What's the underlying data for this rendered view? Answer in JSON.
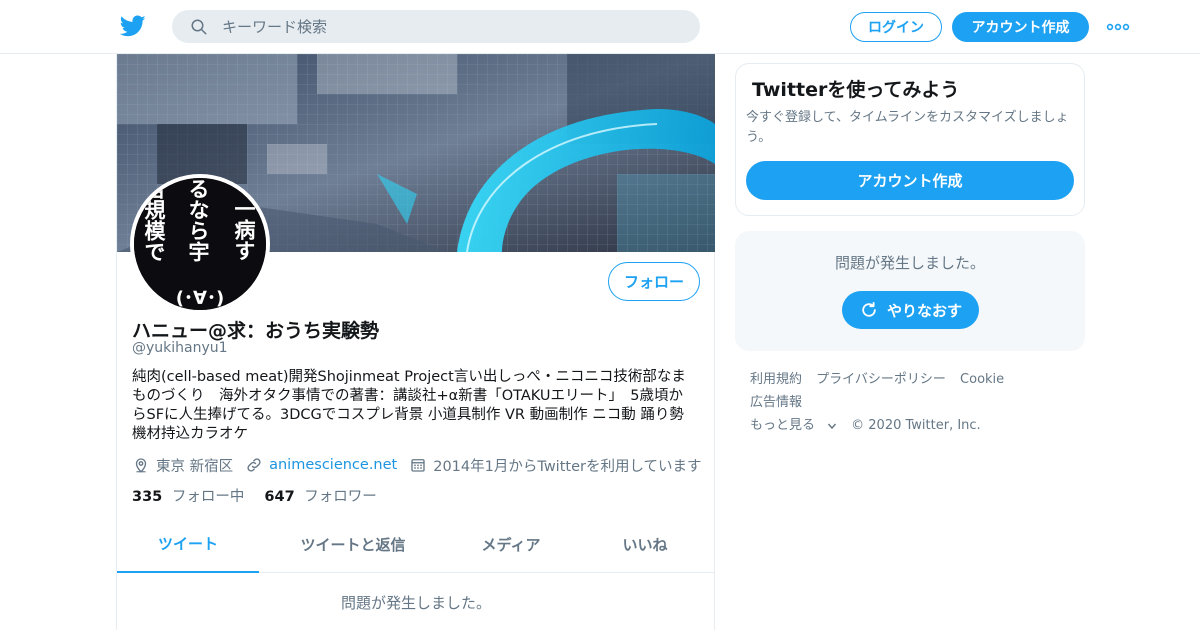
{
  "nav": {
    "search_placeholder": "キーワード検索",
    "login_label": "ログイン",
    "signup_label": "アカウント作成",
    "more_icon": "more-dots-icon",
    "logo_icon": "twitter-bird-icon",
    "brand_color": "#1da1f2"
  },
  "profile": {
    "avatar_text": [
      "宙規模で",
      "るなら宇",
      "一病す"
    ],
    "avatar_face": "(･∀･)",
    "follow_label": "フォロー",
    "display_name": "ハニュー@求：おうち実験勢",
    "handle": "@yukihanyu1",
    "bio": "純肉(cell-based meat)開発Shojinmeat Project言い出しっぺ・ニコニコ技術部なまものづくり　海外オタク事情での著書：講談社+α新書「OTAKUエリート」　5歳頃からSFに人生捧げてる。3DCGでコスプレ背景 小道具制作 VR 動画制作 ニコ動 踊り勢 機材持込カラオケ",
    "location": "東京 新宿区",
    "website": "animescience.net",
    "joined": "2014年1月からTwitterを利用しています",
    "following_count": "335",
    "following_label": "フォロー中",
    "followers_count": "647",
    "followers_label": "フォロワー"
  },
  "tabs": [
    {
      "label": "ツイート",
      "active": true
    },
    {
      "label": "ツイートと返信",
      "active": false
    },
    {
      "label": "メディア",
      "active": false
    },
    {
      "label": "いいね",
      "active": false
    }
  ],
  "timeline_error": "問題が発生しました。",
  "signup_card": {
    "title": "Twitterを使ってみよう",
    "description": "今すぐ登録して、タイムラインをカスタマイズしましょう。",
    "button_label": "アカウント作成"
  },
  "error_box": {
    "message": "問題が発生しました。",
    "retry_label": "やりなおす"
  },
  "footer": {
    "links": [
      "利用規約",
      "プライバシーポリシー",
      "Cookie",
      "広告情報"
    ],
    "more_label": "もっと見る",
    "copyright": "© 2020 Twitter, Inc."
  }
}
